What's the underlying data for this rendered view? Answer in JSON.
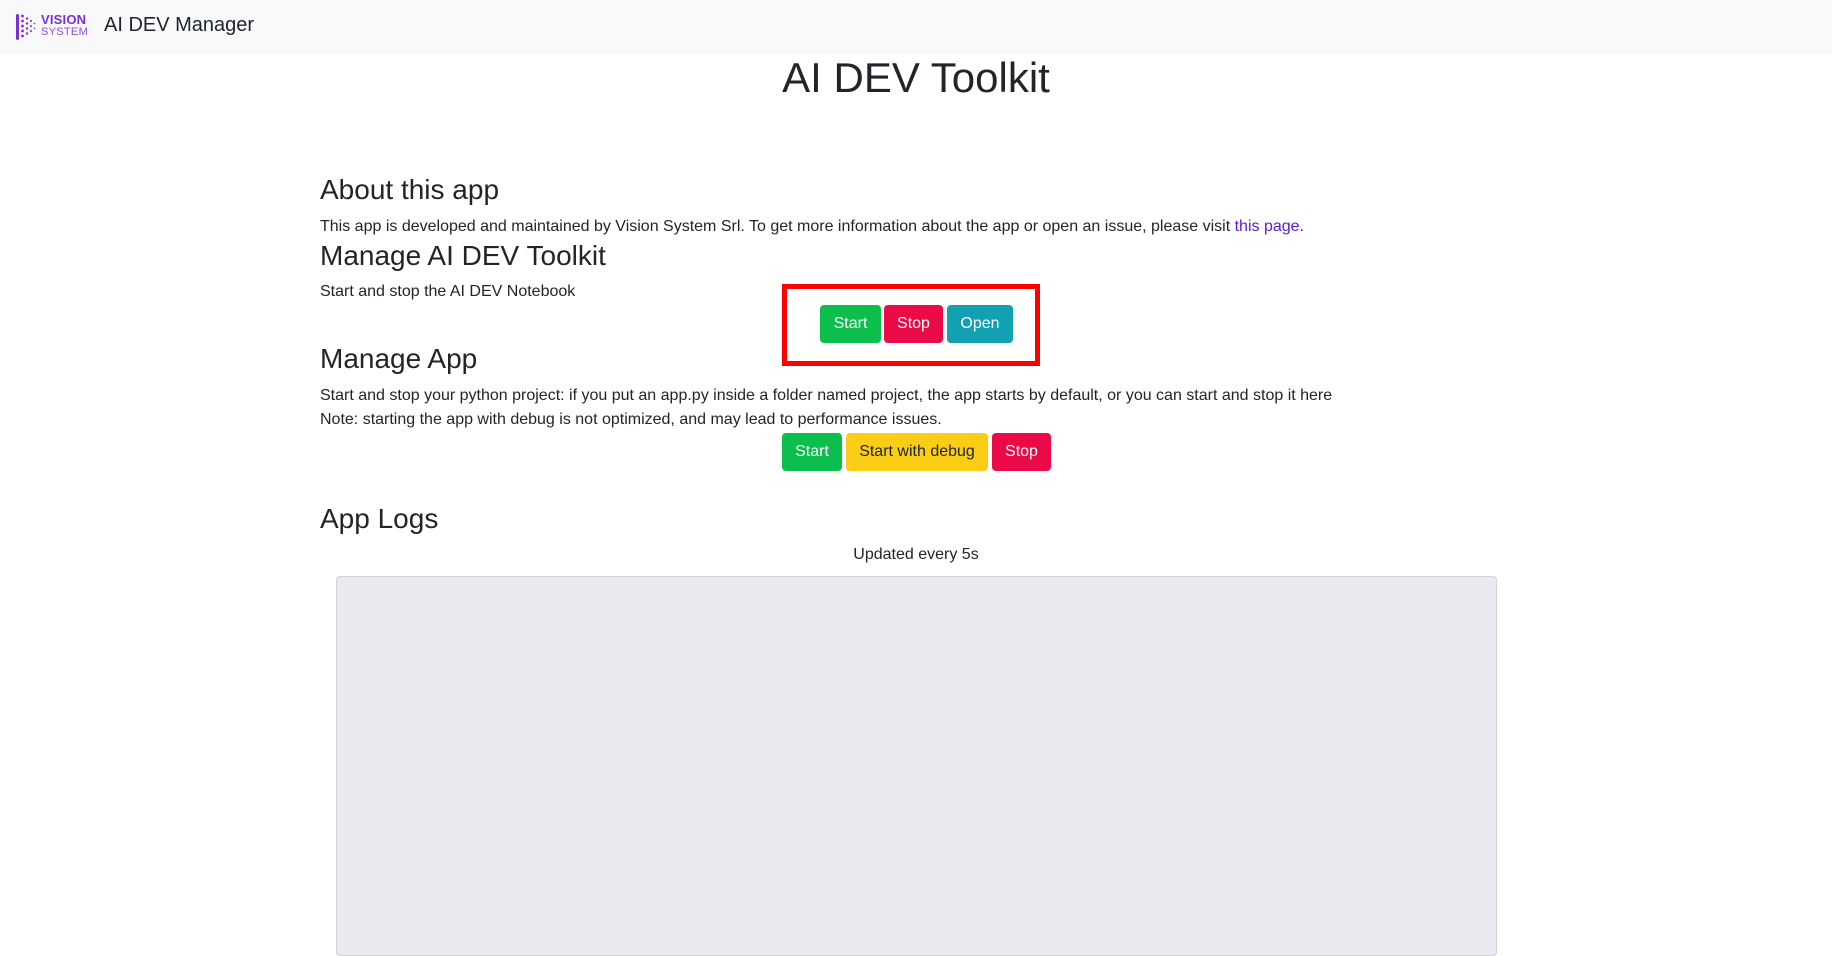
{
  "navbar": {
    "logo_top": "VISION",
    "logo_bottom": "SYSTEM",
    "brand": "AI DEV Manager"
  },
  "page": {
    "title": "AI DEV Toolkit"
  },
  "about": {
    "heading": "About this app",
    "text_before": "This app is developed and maintained by Vision System Srl. To get more information about the app or open an issue, please visit ",
    "link_text": "this page",
    "text_after": "."
  },
  "toolkit": {
    "heading": "Manage AI DEV Toolkit",
    "description": "Start and stop the AI DEV Notebook",
    "start_label": "Start",
    "stop_label": "Stop",
    "open_label": "Open"
  },
  "app": {
    "heading": "Manage App",
    "description": "Start and stop your python project: if you put an app.py inside a folder named project, the app starts by default, or you can start and stop it here",
    "note": "Note: starting the app with debug is not optimized, and may lead to performance issues.",
    "start_label": "Start",
    "start_debug_label": "Start with debug",
    "stop_label": "Stop"
  },
  "logs": {
    "heading": "App Logs",
    "updated_text": "Updated every 5s",
    "content": ""
  },
  "colors": {
    "success": "#0cbf4d",
    "danger": "#ea0a47",
    "info": "#12a0b3",
    "warning": "#fbcd17",
    "highlight": "#ff0000",
    "brand": "#7b2fd0"
  }
}
